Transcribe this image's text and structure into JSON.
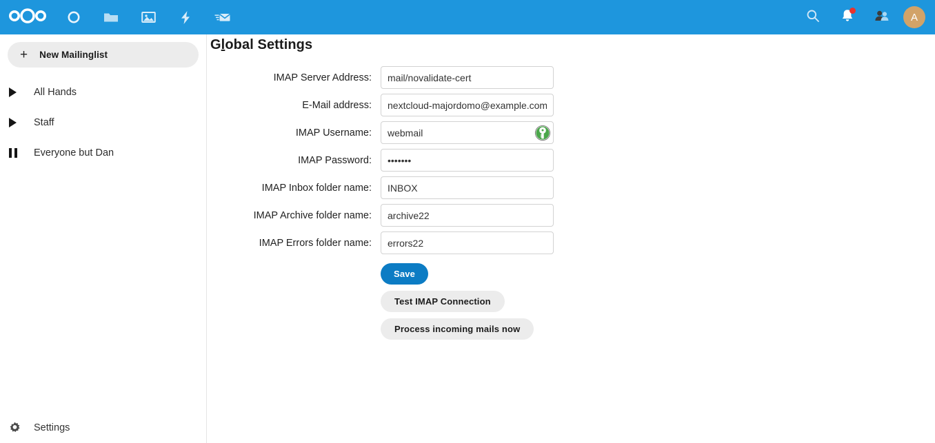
{
  "header": {
    "logo": "nextcloud-logo",
    "nav_items": [
      {
        "name": "dashboard",
        "icon": "circle-ring-icon"
      },
      {
        "name": "files",
        "icon": "folder-icon"
      },
      {
        "name": "photos",
        "icon": "image-icon"
      },
      {
        "name": "activity",
        "icon": "lightning-bolt-icon"
      },
      {
        "name": "mail",
        "icon": "envelope-icon"
      }
    ],
    "search_icon": "search-icon",
    "notifications_icon": "bell-icon",
    "notifications_badge": true,
    "contacts_icon": "contacts-icon",
    "avatar_initial": "A",
    "avatar_color": "#d2a368",
    "background_color": "#1e96dd"
  },
  "sidebar": {
    "new_button_label": "New Mailinglist",
    "new_button_icon": "plus-icon",
    "items": [
      {
        "label": "All Hands",
        "icon": "play-triangle-icon"
      },
      {
        "label": "Staff",
        "icon": "play-triangle-icon"
      },
      {
        "label": "Everyone but Dan",
        "icon": "pause-icon"
      }
    ],
    "settings_label": "Settings",
    "settings_icon": "gear-icon"
  },
  "main": {
    "title_prefix": "G",
    "title_accesskey": "l",
    "title_suffix": "obal Settings",
    "title_full": "Global Settings",
    "fields": [
      {
        "label": "IMAP Server Address:",
        "value": "mail/novalidate-cert",
        "placeholder": "",
        "type": "text",
        "name": "imap-server-address"
      },
      {
        "label": "E-Mail address:",
        "value": "nextcloud-majordomo@example.com",
        "placeholder": "",
        "type": "text",
        "name": "email-address"
      },
      {
        "label": "IMAP Username:",
        "value": "webmail",
        "placeholder": "",
        "type": "text",
        "name": "imap-username",
        "trailing_icon": "keepassxc-icon"
      },
      {
        "label": "IMAP Password:",
        "value": "1234567",
        "placeholder": "",
        "type": "password",
        "name": "imap-password"
      },
      {
        "label": "IMAP Inbox folder name:",
        "value": "INBOX",
        "placeholder": "",
        "type": "text",
        "name": "imap-inbox-folder"
      },
      {
        "label": "IMAP Archive folder name:",
        "value": "archive22",
        "placeholder": "",
        "type": "text",
        "name": "imap-archive-folder"
      },
      {
        "label": "IMAP Errors folder name:",
        "value": "errors22",
        "placeholder": "",
        "type": "text",
        "name": "imap-errors-folder"
      }
    ],
    "save_label": "Save",
    "test_connection_label": "Test IMAP Connection",
    "process_mails_label": "Process incoming mails now",
    "primary_color": "#0c7cc4"
  }
}
